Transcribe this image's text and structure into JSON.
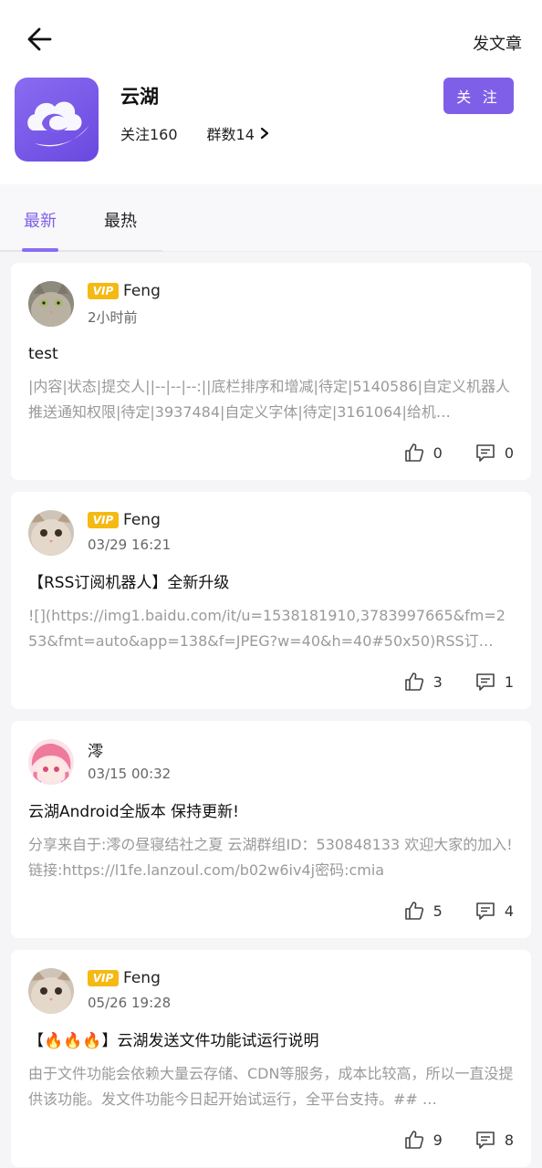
{
  "header": {
    "post_article_label": "发文章",
    "group_name": "云湖",
    "following": "关注160",
    "groups": "群数14",
    "follow_button": "关 注"
  },
  "tabs": [
    {
      "label": "最新",
      "active": true
    },
    {
      "label": "最热",
      "active": false
    }
  ],
  "colors": {
    "accent": "#7f5fe8",
    "vip": "#f5b914"
  },
  "posts": [
    {
      "vip": "VIP",
      "author": "Feng",
      "time": "2小时前",
      "title": "test",
      "body": "|内容|状态|提交人||--|--|--:||底栏排序和增减|待定|5140586|自定义机器人推送通知权限|待定|3937484|自定义字体|待定|3161064|给机…",
      "likes": "0",
      "comments": "0"
    },
    {
      "vip": "VIP",
      "author": "Feng",
      "time": "03/29 16:21",
      "title": "【RSS订阅机器人】全新升级",
      "body": "![](https://img1.baidu.com/it/u=1538181910,3783997665&fm=253&fmt=auto&app=138&f=JPEG?w=40&h=40#50x50)RSS订…",
      "likes": "3",
      "comments": "1"
    },
    {
      "vip": "",
      "author": "澪",
      "time": "03/15 00:32",
      "title": "云湖Android全版本 保持更新!",
      "body": "分享来自于:澪の昼寝结社之夏 云湖群组ID：530848133 欢迎大家的加入!链接:https://l1fe.lanzoul.com/b02w6iv4j密码:cmia",
      "likes": "5",
      "comments": "4"
    },
    {
      "vip": "VIP",
      "author": "Feng",
      "time": "05/26 19:28",
      "title": "【🔥🔥🔥】云湖发送文件功能试运行说明",
      "body": "由于文件功能会依赖大量云存储、CDN等服务，成本比较高，所以一直没提供该功能。发文件功能今日起开始试运行，全平台支持。## …",
      "likes": "9",
      "comments": "8"
    }
  ]
}
